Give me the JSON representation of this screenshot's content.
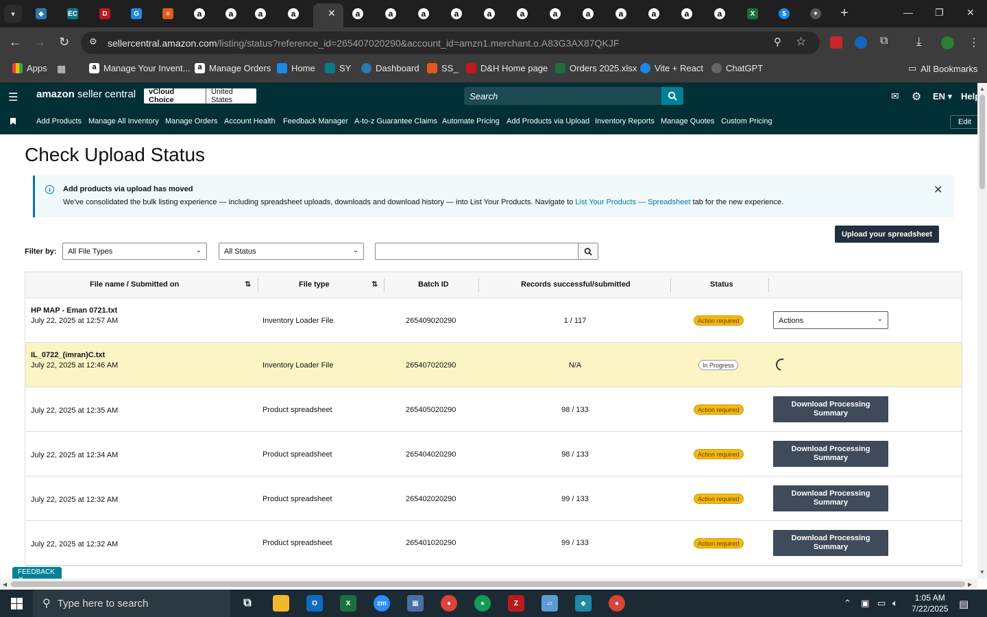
{
  "browser": {
    "url_host": "sellercentral.amazon.com",
    "url_path": "/listing/status?reference_id=265407020290&account_id=amzn1.merchant.o.A83G3AX87QKJF",
    "bookmarks": [
      "Apps",
      "Manage Your Invent...",
      "Manage Orders",
      "Home",
      "SY",
      "Dashboard",
      "SS_",
      "D&H Home page",
      "Orders 2025.xlsx",
      "Vite + React",
      "ChatGPT"
    ],
    "all_bookmarks": "All Bookmarks"
  },
  "header": {
    "logo_main": "amazon",
    "logo_sub": " seller central",
    "store_name": "vCloud Choice",
    "store_region": "United States",
    "search_placeholder": "Search",
    "language": "EN ▾",
    "help": "Help"
  },
  "nav": {
    "items": [
      "Add Products",
      "Manage All Inventory",
      "Manage Orders",
      "Account Health",
      "Feedback Manager",
      "A-to-z Guarantee Claims",
      "Automate Pricing",
      "Add Products via Upload",
      "Inventory Reports",
      "Manage Quotes",
      "Custom Pricing"
    ],
    "edit": "Edit"
  },
  "page": {
    "title": "Check Upload Status",
    "alert_title": "Add products via upload has moved",
    "alert_body": "We've consolidated the bulk listing experience — including spreadsheet uploads, downloads and download history — into List Your Products. Navigate to ",
    "alert_link": "List Your Products — Spreadsheet",
    "alert_tail": " tab for the new experience.",
    "upload_button": "Upload your spreadsheet",
    "filter_label": "Filter by:",
    "filter_file_types": "All File Types",
    "filter_status": "All Status",
    "feedback": "FEEDBACK ✕"
  },
  "table": {
    "headers": [
      "File name / Submitted on",
      "File type",
      "Batch ID",
      "Records successful/submitted",
      "Status"
    ],
    "rows": [
      {
        "name": "HP MAP - Eman 0721.txt",
        "date": "July 22, 2025 at 12:57 AM",
        "type": "Inventory Loader File",
        "batch": "265409020290",
        "records": "1 / 117",
        "status": "Action required",
        "action": "Actions"
      },
      {
        "name": "IL_0722_(imran)C.txt",
        "date": "July 22, 2025 at 12:46 AM",
        "type": "Inventory Loader File",
        "batch": "265407020290",
        "records": "N/A",
        "status": "In Progress",
        "action": ""
      },
      {
        "name": "",
        "date": "July 22, 2025 at 12:35 AM",
        "type": "Product spreadsheet",
        "batch": "265405020290",
        "records": "98 / 133",
        "status": "Action required",
        "action": "Download Processing Summary"
      },
      {
        "name": "",
        "date": "July 22, 2025 at 12:34 AM",
        "type": "Product spreadsheet",
        "batch": "265404020290",
        "records": "98 / 133",
        "status": "Action required",
        "action": "Download Processing Summary"
      },
      {
        "name": "",
        "date": "July 22, 2025 at 12:32 AM",
        "type": "Product spreadsheet",
        "batch": "265402020290",
        "records": "99 / 133",
        "status": "Action required",
        "action": "Download Processing Summary"
      },
      {
        "name": "",
        "date": "July 22, 2025 at 12:32 AM",
        "type": "Product spreadsheet",
        "batch": "265401020290",
        "records": "99 / 133",
        "status": "Action required",
        "action": "Download Processing Summary"
      }
    ]
  },
  "taskbar": {
    "search_placeholder": "Type here to search",
    "time": "1:05 AM",
    "date": "7/22/2025"
  }
}
